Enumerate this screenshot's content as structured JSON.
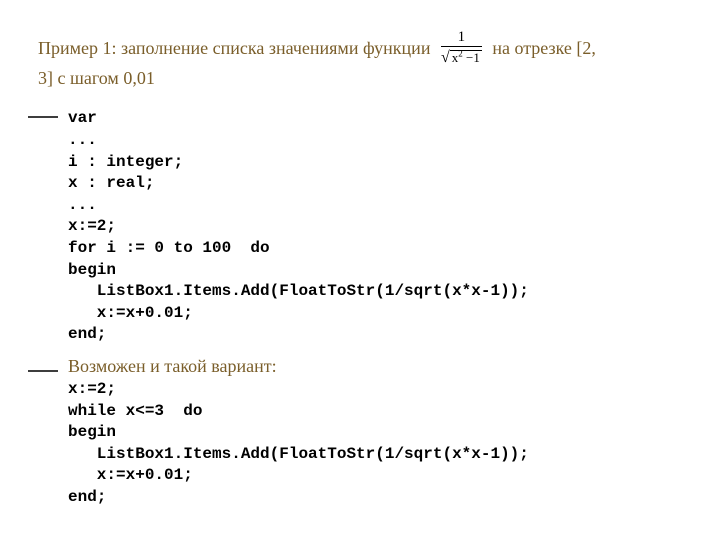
{
  "title": {
    "part1": "Пример 1: заполнение списка значениями функции",
    "part2": "на отрезке [2,",
    "part3": "3] с шагом 0,01"
  },
  "formula": {
    "numerator": "1",
    "radicand_base": "x",
    "radicand_exp": "2",
    "radicand_tail": " −1"
  },
  "code1": "var\n...\ni : integer;\nx : real;\n...\nx:=2;\nfor i := 0 to 100  do\nbegin\n   ListBox1.Items.Add(FloatToStr(1/sqrt(x*x-1));\n   x:=x+0.01;\nend;",
  "subheading": "Возможен и такой вариант:",
  "code2": "x:=2;\nwhile x<=3  do\nbegin\n   ListBox1.Items.Add(FloatToStr(1/sqrt(x*x-1));\n   x:=x+0.01;\nend;"
}
